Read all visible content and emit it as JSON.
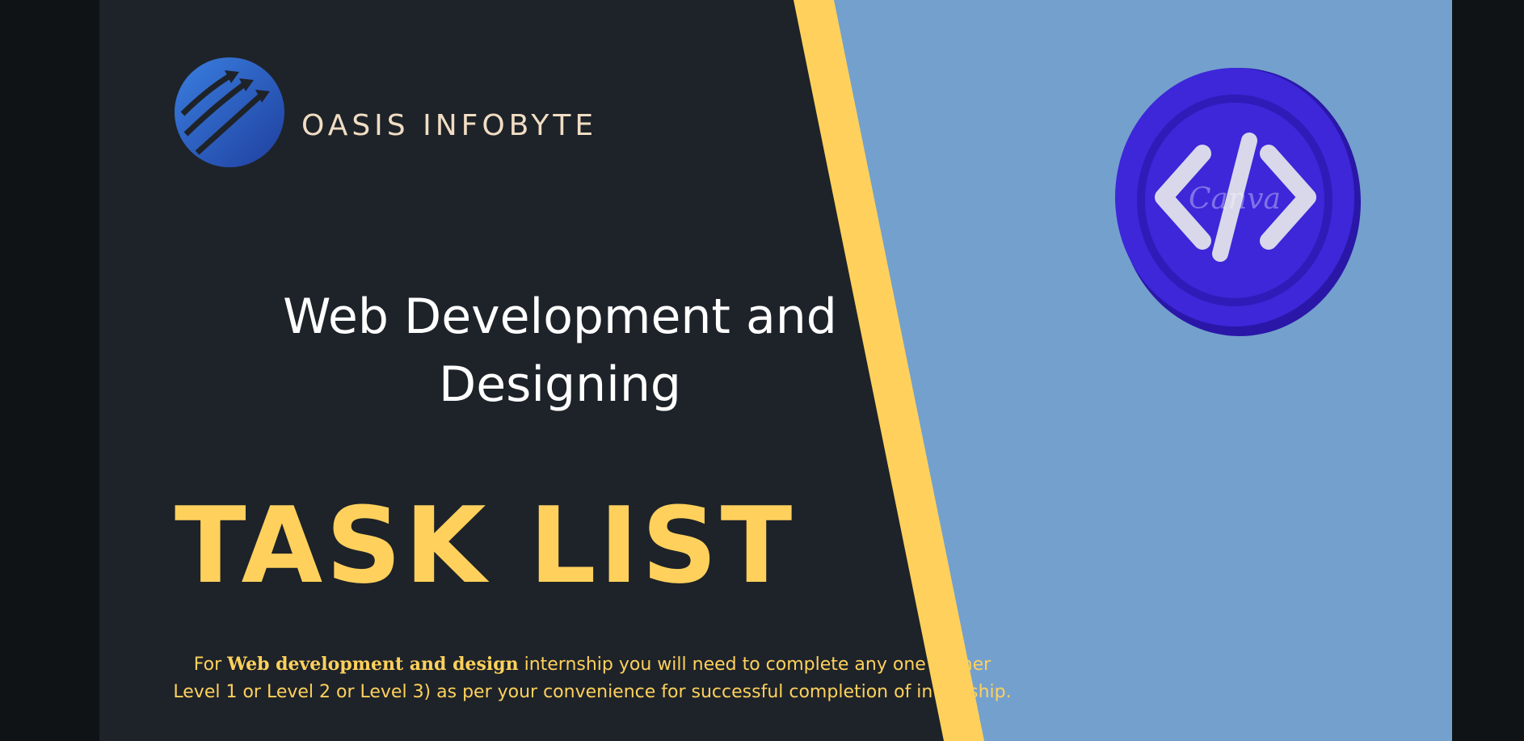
{
  "brand": {
    "name": "OASIS INFOBYTE"
  },
  "subtitle": {
    "line1": "Web Development and",
    "line2": "Designing"
  },
  "title": "TASK LIST",
  "description": {
    "prefix": "For ",
    "emphasis": "Web development and design",
    "rest": " internship you will need to complete any one (either Level 1 or Level 2 or Level 3) as per your convenience for successful completion of internship."
  },
  "watermark": "Canva",
  "colors": {
    "background_dark": "#1e2329",
    "accent_yellow": "#ffd15c",
    "panel_blue": "#74a0cd",
    "coin_purple": "#3d27d9",
    "brand_text": "#f1ddc3",
    "viewer_bg": "#0f1316"
  },
  "icons": {
    "logo": "arrows-globe-logo-icon",
    "coin": "code-brackets-icon"
  }
}
